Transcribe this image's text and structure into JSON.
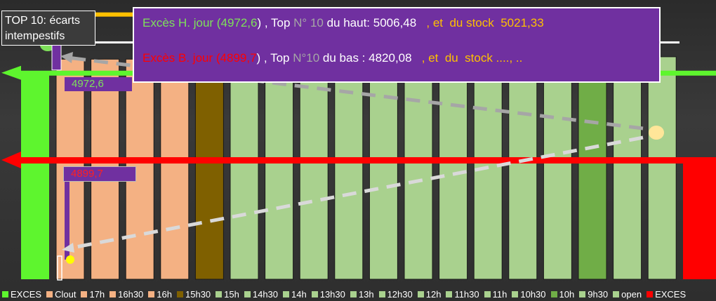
{
  "chart_data": {
    "type": "bar",
    "categories": [
      "Clout",
      "17h",
      "16h30",
      "16h",
      "15h30",
      "15h",
      "14h30",
      "14h",
      "13h30",
      "13h",
      "12h30",
      "12h",
      "11h30",
      "11h",
      "10h30",
      "10h",
      "9h30",
      "open"
    ],
    "colors": [
      "#f4b183",
      "#f4b183",
      "#f4b183",
      "#f4b183",
      "#7f6000",
      "#a9d18e",
      "#a9d18e",
      "#a9d18e",
      "#a9d18e",
      "#a9d18e",
      "#a9d18e",
      "#a9d18e",
      "#a9d18e",
      "#a9d18e",
      "#a9d18e",
      "#70ad47",
      "#a9d18e",
      "#a9d18e"
    ],
    "ylim": [
      4800,
      5010
    ],
    "values": [
      4984,
      4984,
      4984,
      4984,
      4985,
      4985,
      4985,
      4985,
      4985,
      4985,
      4985,
      4985,
      4985,
      4985,
      4985,
      4985,
      4985,
      4986
    ],
    "exces_h": {
      "label": "EXCES",
      "value": 4972.6,
      "color": "#5ef52e"
    },
    "exces_b": {
      "label": "EXCES",
      "value": 4899.7,
      "color": "#ff0000"
    },
    "top_high": 5006.48,
    "top_low": 4820.08,
    "stock_high": 5021.33,
    "white_line": 4998,
    "legend": [
      "EXCES",
      "Clout",
      "17h",
      "16h30",
      "16h",
      "15h30",
      "15h",
      "14h30",
      "14h",
      "13h30",
      "13h",
      "12h30",
      "12h",
      "11h30",
      "11h",
      "10h30",
      "10h",
      "9h30",
      "open",
      "EXCES"
    ],
    "legend_colors": [
      "#5ef52e",
      "#f4b183",
      "#f4b183",
      "#f4b183",
      "#f4b183",
      "#7f6000",
      "#a9d18e",
      "#a9d18e",
      "#a9d18e",
      "#a9d18e",
      "#a9d18e",
      "#a9d18e",
      "#a9d18e",
      "#a9d18e",
      "#a9d18e",
      "#a9d18e",
      "#70ad47",
      "#a9d18e",
      "#a9d18e",
      "#ff0000"
    ]
  },
  "top10_label": "TOP 10: écarts intempestifs",
  "label_high": "4972,6",
  "label_low": "4899,7",
  "info": {
    "line1": [
      {
        "text": "Excès H. jour (",
        "color": "#7ee05a"
      },
      {
        "text": "4972,6",
        "color": "#7ee05a"
      },
      {
        "text": ") , Top ",
        "color": "#ffffff"
      },
      {
        "text": "N° 10",
        "color": "#a6a6a6"
      },
      {
        "text": " du haut: 5006,48   ",
        "color": "#ffffff"
      },
      {
        "text": ", et  du stock  5021,33",
        "color": "#ffc000"
      }
    ],
    "line2": [
      {
        "text": "Excès B. jour (",
        "color": "#ff0000"
      },
      {
        "text": "4899,7",
        "color": "#ff0000"
      },
      {
        "text": ") , Top ",
        "color": "#ffffff"
      },
      {
        "text": "N°10",
        "color": "#a6a6a6"
      },
      {
        "text": " du bas : 4820,08   ",
        "color": "#ffffff"
      },
      {
        "text": ", et  du  stock ...., ..",
        "color": "#ffc000"
      }
    ]
  }
}
